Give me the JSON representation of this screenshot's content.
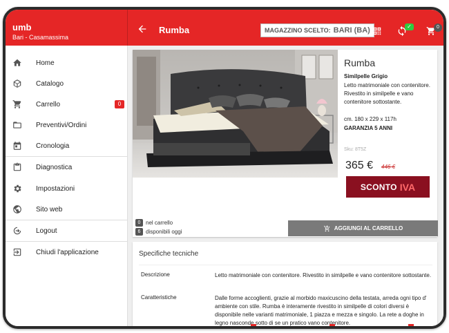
{
  "app": {
    "name": "umb",
    "location": "Bari - Casamassima"
  },
  "header": {
    "title": "Rumba",
    "warehouse_label": "MAGAZZINO SCELTO:",
    "warehouse_value": "BARI (BA)",
    "cart_count": "0",
    "sync_check": "✓"
  },
  "sidebar": {
    "items": [
      {
        "label": "Home",
        "icon": "home-icon"
      },
      {
        "label": "Catalogo",
        "icon": "box-icon"
      },
      {
        "label": "Carrello",
        "icon": "cart-icon",
        "badge": "0"
      },
      {
        "label": "Preventivi/Ordini",
        "icon": "folder-icon"
      },
      {
        "label": "Cronologia",
        "icon": "calendar-icon"
      },
      {
        "label": "Diagnostica",
        "icon": "clipboard-icon"
      },
      {
        "label": "Impostazioni",
        "icon": "gear-icon"
      },
      {
        "label": "Sito web",
        "icon": "globe-icon"
      },
      {
        "label": "Logout",
        "icon": "logout-icon"
      },
      {
        "label": "Chiudi l'applicazione",
        "icon": "exit-icon"
      }
    ]
  },
  "product": {
    "name": "Rumba",
    "variant": "Similpelle Grigio",
    "description": "Letto matrimoniale con contenitore. Rivestito in similpelle e vano contenitore sottostante.",
    "dimensions": "cm. 180 x 229 x 117h",
    "warranty": "GARANZIA 5 ANNI",
    "sku": "Sku: 8T5Z",
    "price": "365 €",
    "old_price": "446 €",
    "promo_part1": "SCONTO",
    "promo_part2": "IVA",
    "in_cart_count": "0",
    "in_cart_label": "nel carrello",
    "available_count": "6",
    "available_label": "disponibili oggi",
    "add_button": "AGGIUNGI AL CARRELLO"
  },
  "specs": {
    "title": "Specifiche tecniche",
    "rows": [
      {
        "label": "Descrizione",
        "value": "Letto matrimoniale con contenitore. Rivestito in similpelle e vano contenitore sottostante."
      },
      {
        "label": "Caratteristiche",
        "value": "Dalle forme accoglienti, grazie al morbido maxicuscino della testata, arreda ogni tipo d' ambiente con stile. Rumba è interamente rivestito in similpelle di colori diversi è disponibile nelle varianti matrimoniale, 1 piazza e mezza e singolo. La rete a doghe in legno nasconde sotto di se un pratico vano contenitore."
      }
    ]
  },
  "colors": {
    "brand": "#e52626",
    "promo": "#8a1020",
    "button": "#7a7a7a"
  }
}
